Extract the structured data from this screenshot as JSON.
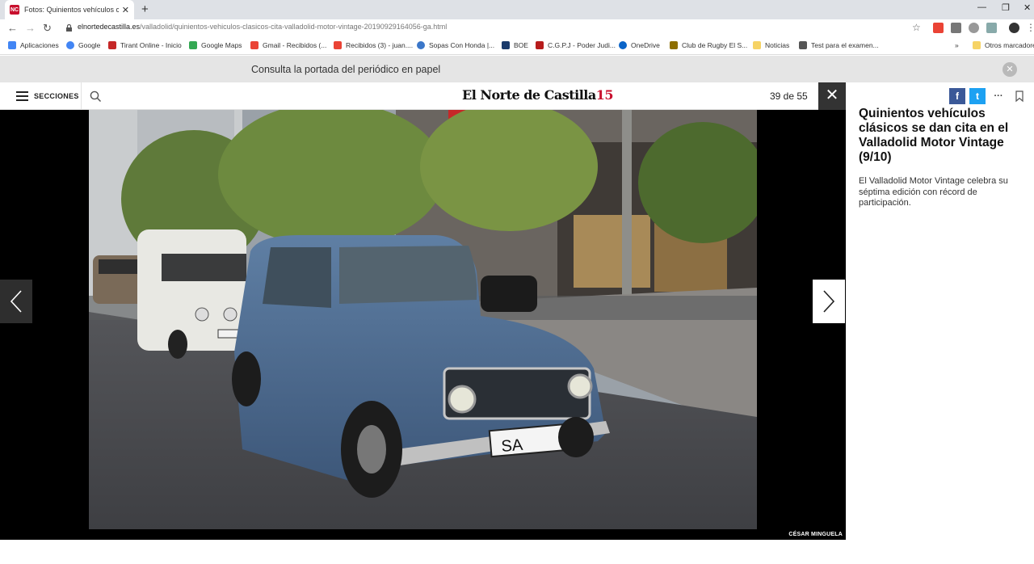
{
  "browser": {
    "tab_title": "Fotos: Quinientos vehículos clási",
    "tab_favicon_text": "NC",
    "url_host": "elnortedecastilla.es",
    "url_path": "/valladolid/quinientos-vehiculos-clasicos-cita-valladolid-motor-vintage-20190929164056-ga.html",
    "bookmarks": [
      {
        "label": "Aplicaciones",
        "color": "#4285f4"
      },
      {
        "label": "Google",
        "color": "#4285f4"
      },
      {
        "label": "Tirant Online - Inicio",
        "color": "#c62828"
      },
      {
        "label": "Google Maps",
        "color": "#34a853"
      },
      {
        "label": "Gmail - Recibidos (...",
        "color": "#ea4335"
      },
      {
        "label": "Recibidos (3) - juan....",
        "color": "#ea4335"
      },
      {
        "label": "Sopas Con Honda |...",
        "color": "#3b77c9"
      },
      {
        "label": "BOE",
        "color": "#1a3a6b"
      },
      {
        "label": "C.G.P.J - Poder Judi...",
        "color": "#b71c1c"
      },
      {
        "label": "OneDrive",
        "color": "#0a64c8"
      },
      {
        "label": "Club de Rugby El S...",
        "color": "#8d6e00"
      },
      {
        "label": "Noticias",
        "color": "#f6d365"
      },
      {
        "label": "Test para el examen...",
        "color": "#555555"
      }
    ],
    "bookmarks_overflow": "»",
    "other_bookmarks": "Otros marcadores"
  },
  "banner": {
    "text": "Consulta la portada del periódico en papel",
    "close_glyph": "✕"
  },
  "header": {
    "menu_label": "SECCIONES",
    "logo_text": "El Norte de Castilla",
    "logo_number": "15",
    "counter": "39 de 55",
    "close_glyph": "✕"
  },
  "share": {
    "facebook_glyph": "f",
    "twitter_glyph": "t",
    "more_glyph": "···"
  },
  "gallery": {
    "credit": "CÉSAR MINGUELA",
    "plate_text": "SA"
  },
  "article": {
    "title": "Quinientos vehículos clásicos se dan cita en el Valladolid Motor Vintage (9/10)",
    "description": "El Valladolid Motor Vintage celebra su séptima edición con récord de participación."
  },
  "colors": {
    "brand_red": "#c8102e",
    "facebook": "#3b5998",
    "twitter": "#1da1f2"
  }
}
